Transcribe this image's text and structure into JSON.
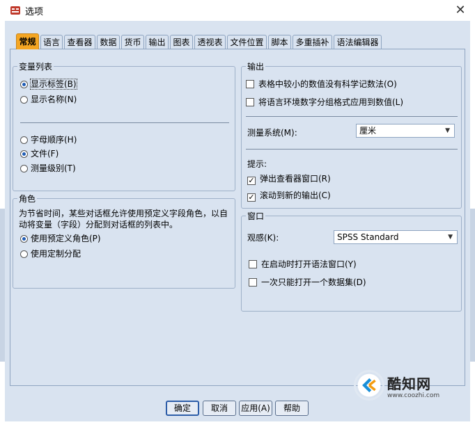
{
  "window": {
    "title": "选项",
    "close_symbol": "✕"
  },
  "tabs": [
    {
      "label": "常规",
      "active": true
    },
    {
      "label": "语言"
    },
    {
      "label": "查看器"
    },
    {
      "label": "数据"
    },
    {
      "label": "货币"
    },
    {
      "label": "输出"
    },
    {
      "label": "图表"
    },
    {
      "label": "透视表"
    },
    {
      "label": "文件位置"
    },
    {
      "label": "脚本"
    },
    {
      "label": "多重插补"
    },
    {
      "label": "语法编辑器"
    }
  ],
  "variable_list": {
    "title": "变量列表",
    "display_options": [
      {
        "label": "显示标签(B)",
        "selected": true
      },
      {
        "label": "显示名称(N)",
        "selected": false
      }
    ],
    "order_options": [
      {
        "label": "字母顺序(H)",
        "selected": false
      },
      {
        "label": "文件(F)",
        "selected": true
      },
      {
        "label": "测量级别(T)",
        "selected": false
      }
    ]
  },
  "roles": {
    "title": "角色",
    "description_line1": "为节省时间，某些对话框允许使用预定义字段角色，以自",
    "description_line2": "动将变量（字段）分配到对话框的列表中。",
    "options": [
      {
        "label": "使用预定义角色(P)",
        "selected": true
      },
      {
        "label": "使用定制分配",
        "selected": false
      }
    ]
  },
  "output": {
    "title": "输出",
    "checkboxes": [
      {
        "label": "表格中较小的数值没有科学记数法(O)",
        "checked": false
      },
      {
        "label": "将语言环境数字分组格式应用到数值(L)",
        "checked": false
      }
    ],
    "measurement_label": "测量系统(M):",
    "measurement_value": "厘米",
    "notify_label": "提示:",
    "notify_options": [
      {
        "label": "弹出查看器窗口(R)",
        "checked": true
      },
      {
        "label": "滚动到新的输出(C)",
        "checked": true
      }
    ]
  },
  "window_group": {
    "title": "窗口",
    "look_label": "观感(K):",
    "look_value": "SPSS Standard",
    "checkboxes": [
      {
        "label": "在启动时打开语法窗口(Y)",
        "checked": false
      },
      {
        "label": "一次只能打开一个数据集(D)",
        "checked": false
      }
    ]
  },
  "buttons": {
    "ok": "确定",
    "cancel": "取消",
    "apply": "应用(A)",
    "help": "帮助"
  },
  "watermark": {
    "text": "酷知网",
    "url": "www.coozhi.com"
  },
  "colors": {
    "active_tab": "#f5a623",
    "dialog_bg": "#d9e3f0",
    "radio_dot": "#1e5bb4"
  }
}
